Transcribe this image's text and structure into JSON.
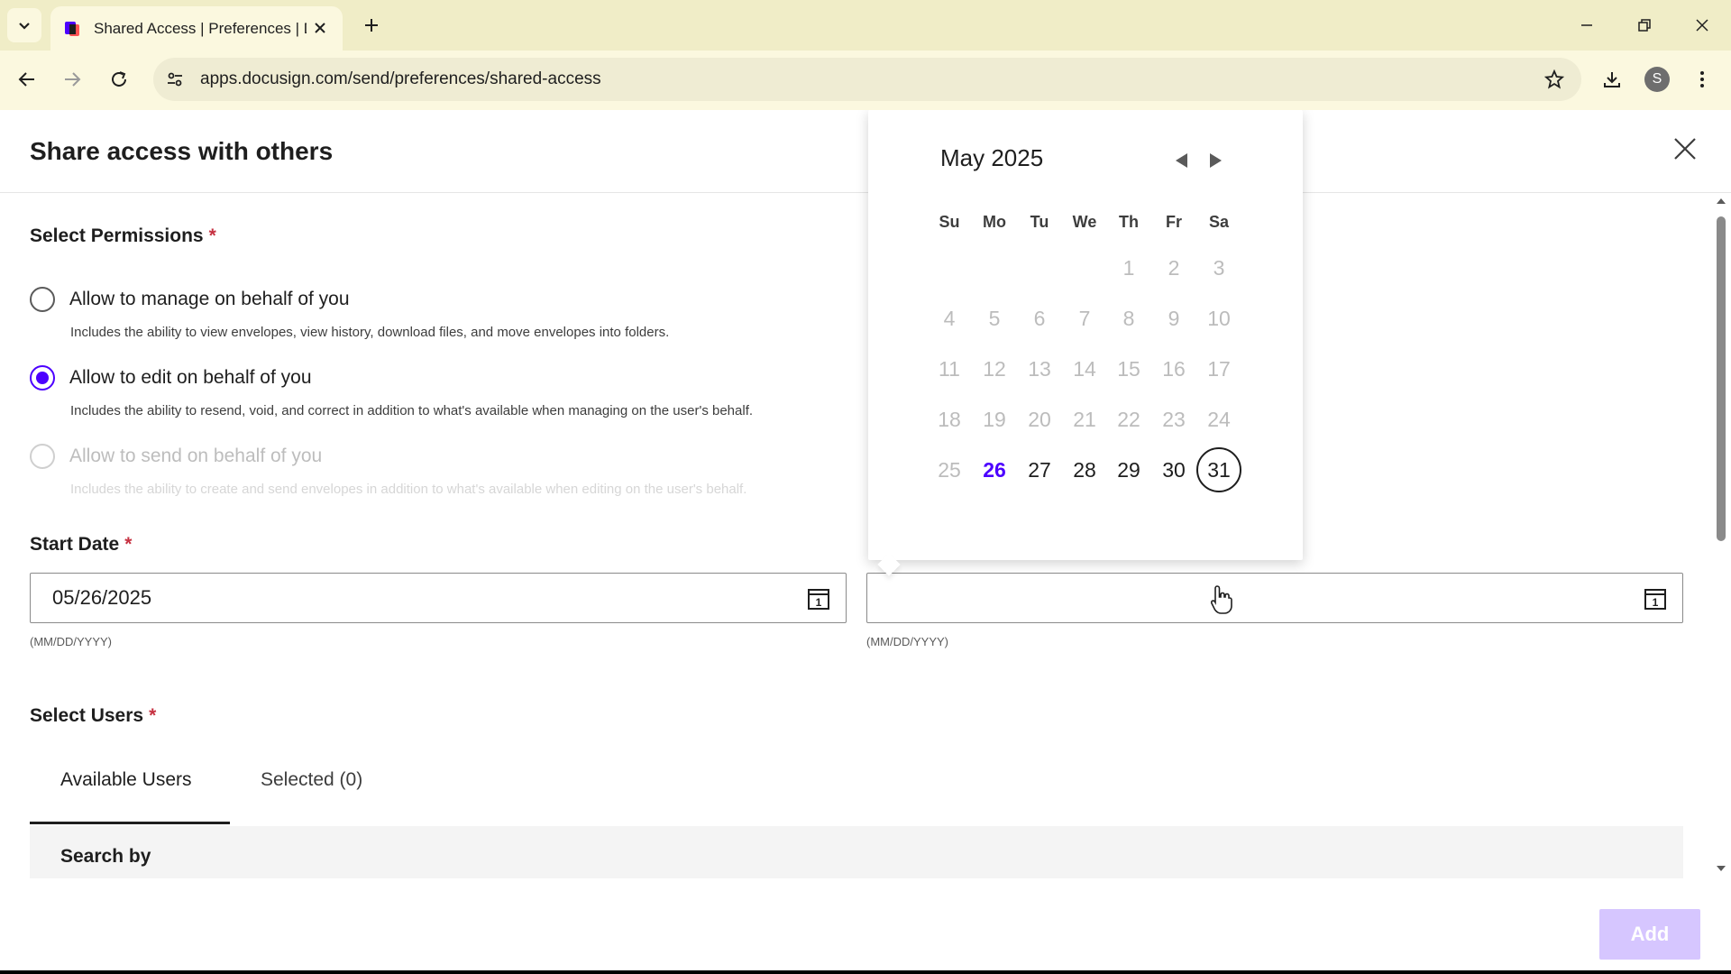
{
  "browser": {
    "tab_title": "Shared Access | Preferences | D",
    "url": "apps.docusign.com/send/preferences/shared-access",
    "profile_initial": "S"
  },
  "modal": {
    "title": "Share access with others",
    "permissions": {
      "label": "Select Permissions",
      "required_mark": "*",
      "options": [
        {
          "label": "Allow to manage on behalf of you",
          "description": "Includes the ability to view envelopes, view history, download files, and move envelopes into folders.",
          "state": "unchecked"
        },
        {
          "label": "Allow to edit on behalf of you",
          "description": "Includes the ability to resend, void, and correct in addition to what's available when managing on the user's behalf.",
          "state": "checked"
        },
        {
          "label": "Allow to send on behalf of you",
          "description": "Includes the ability to create and send envelopes in addition to what's available when editing on the user's behalf.",
          "state": "disabled"
        }
      ]
    },
    "start_date": {
      "label": "Start Date",
      "required_mark": "*",
      "value": "05/26/2025",
      "hint": "(MM/DD/YYYY)"
    },
    "end_date": {
      "label": "",
      "value": "",
      "hint": "(MM/DD/YYYY)"
    },
    "users": {
      "label": "Select Users",
      "required_mark": "*",
      "tabs": [
        "Available Users",
        "Selected (0)"
      ],
      "active_tab": "Available Users",
      "search_label": "Search by"
    },
    "add_button": "Add"
  },
  "calendar": {
    "month_label": "May 2025",
    "weekdays": [
      "Su",
      "Mo",
      "Tu",
      "We",
      "Th",
      "Fr",
      "Sa"
    ],
    "first_weekday_index": 4,
    "days_in_month": 31,
    "selected_day": 26,
    "hovered_day": 31,
    "min_enabled_day": 26
  },
  "colors": {
    "accent": "#4c00ff",
    "required": "#c63141",
    "add_button_disabled": "#d6c6ff",
    "chrome_tabbar": "#f0edc7",
    "chrome_toolbar": "#fbf8df"
  }
}
